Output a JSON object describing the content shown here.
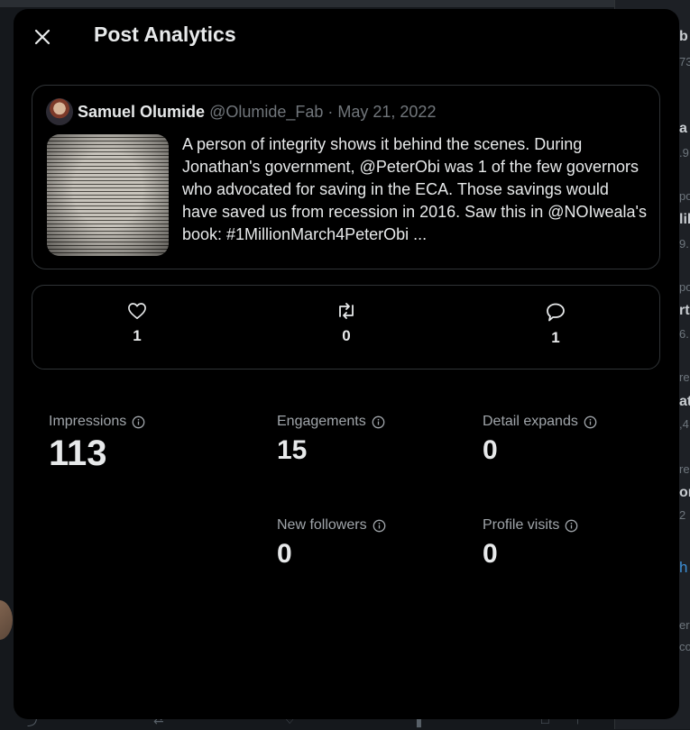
{
  "background": {
    "right_fragments": [
      {
        "text": "b",
        "style": "bold"
      },
      {
        "text": "73",
        "style": "small"
      },
      {
        "text": "a",
        "style": "bold"
      },
      {
        "text": ".9",
        "style": "small"
      },
      {
        "text": "po",
        "style": "small"
      },
      {
        "text": "lil",
        "style": "bold"
      },
      {
        "text": "9.",
        "style": "small"
      },
      {
        "text": "po",
        "style": "small"
      },
      {
        "text": "rt",
        "style": "bold"
      },
      {
        "text": "6.",
        "style": "small"
      },
      {
        "text": "re",
        "style": "small"
      },
      {
        "text": "at",
        "style": "bold"
      },
      {
        "text": ",4",
        "style": "small"
      },
      {
        "text": "re",
        "style": "small"
      },
      {
        "text": "or",
        "style": "bold"
      },
      {
        "text": "2",
        "style": "small"
      },
      {
        "text": "h",
        "style": "link"
      },
      {
        "text": "er",
        "style": "small"
      },
      {
        "text": "co",
        "style": "small"
      }
    ]
  },
  "modal": {
    "title": "Post Analytics",
    "close_icon": "close-icon"
  },
  "tweet": {
    "author_name": "Samuel Olumide",
    "meta": "@Olumide_Fab · May 21, 2022",
    "text": "A person of integrity shows it behind the scenes. During Jonathan's government, @PeterObi was 1 of the few governors who advocated for saving in the ECA. Those savings would have saved us from recession in 2016. Saw this in @NOIweala's book: #1MillionMarch4PeterObi ..."
  },
  "engagement": {
    "likes": "1",
    "retweets": "0",
    "replies": "1",
    "icons": [
      "heart-icon",
      "retweet-icon",
      "reply-icon"
    ]
  },
  "metrics": {
    "impressions": {
      "label": "Impressions",
      "value": "113"
    },
    "engagements": {
      "label": "Engagements",
      "value": "15"
    },
    "detail_expands": {
      "label": "Detail expands",
      "value": "0"
    },
    "new_followers": {
      "label": "New followers",
      "value": "0"
    },
    "profile_visits": {
      "label": "Profile visits",
      "value": "0"
    }
  },
  "colors": {
    "modal_bg": "#000000",
    "text_primary": "#e7e9ea",
    "text_secondary": "#71767b",
    "border": "#2f3336",
    "link": "#3d8fd6"
  }
}
